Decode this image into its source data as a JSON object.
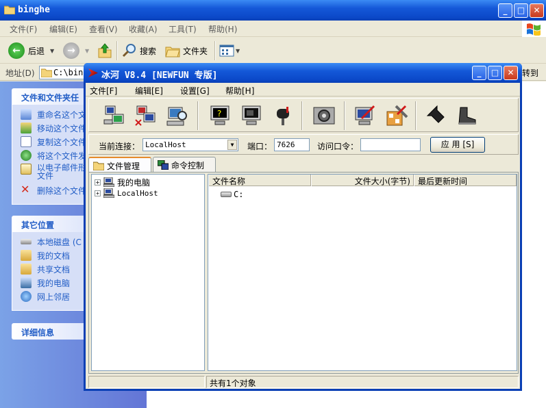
{
  "explorer": {
    "title": "binghe",
    "menu": [
      "文件(F)",
      "编辑(E)",
      "查看(V)",
      "收藏(A)",
      "工具(T)",
      "帮助(H)"
    ],
    "toolbar": {
      "back": "后退",
      "search": "搜索",
      "folders": "文件夹"
    },
    "address": {
      "label": "地址(D)",
      "value": "C:\\bing",
      "go": "转到"
    },
    "tasks": {
      "file_tasks_title": "文件和文件夹任",
      "file_tasks": [
        "重命名这个文",
        "移动这个文件",
        "复制这个文件",
        "将这个文件发",
        "以电子邮件形",
        "删除这个文件"
      ],
      "email_second_line": "文件",
      "other_places_title": "其它位置",
      "other_places": [
        "本地磁盘 (C",
        "我的文档",
        "共享文档",
        "我的电脑",
        "网上邻居"
      ],
      "details_title": "详细信息"
    }
  },
  "bh": {
    "title": "冰河 V8.4 [NEWFUN 专版]",
    "menu": [
      "文件[F]",
      "编辑[E]",
      "设置[G]",
      "帮助[H]"
    ],
    "connection": {
      "label": "当前连接：",
      "value": "LocalHost",
      "port_label": "端口：",
      "port": "7626",
      "password_label": "访问口令：",
      "password": "",
      "apply": "应 用 [S]"
    },
    "tabs": [
      "文件管理器",
      "命令控制台"
    ],
    "tree": [
      "我的电脑",
      "LocalHost"
    ],
    "columns": [
      "文件名称",
      "文件大小(字节)",
      "最后更新时间"
    ],
    "files": [
      "C:"
    ],
    "status": "共有1个对象"
  },
  "colors": {
    "title_blue": "#0b48c8",
    "task_link": "#215dc6",
    "close_red": "#c8391d"
  }
}
